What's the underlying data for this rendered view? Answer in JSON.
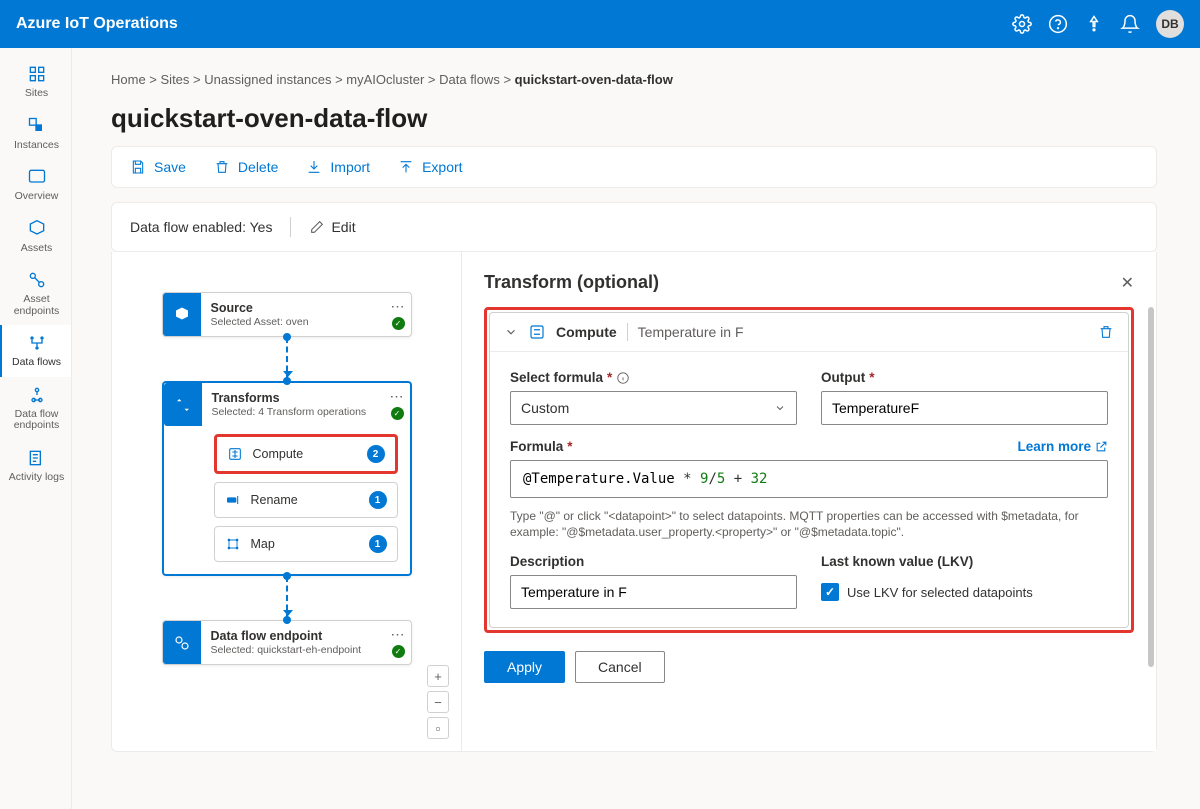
{
  "header": {
    "product": "Azure IoT Operations",
    "avatar": "DB"
  },
  "sidebar": {
    "items": [
      {
        "label": "Sites"
      },
      {
        "label": "Instances"
      },
      {
        "label": "Overview"
      },
      {
        "label": "Assets"
      },
      {
        "label": "Asset endpoints"
      },
      {
        "label": "Data flows"
      },
      {
        "label": "Data flow endpoints"
      },
      {
        "label": "Activity logs"
      }
    ]
  },
  "breadcrumbs": {
    "parts": [
      "Home",
      "Sites",
      "Unassigned instances",
      "myAIOcluster",
      "Data flows"
    ],
    "current": "quickstart-oven-data-flow"
  },
  "page": {
    "title": "quickstart-oven-data-flow"
  },
  "toolbar": {
    "save": "Save",
    "delete": "Delete",
    "import": "Import",
    "export": "Export"
  },
  "status": {
    "label": "Data flow enabled:",
    "value": "Yes",
    "edit": "Edit"
  },
  "canvas": {
    "source": {
      "title": "Source",
      "subtitle": "Selected Asset: oven"
    },
    "transforms": {
      "title": "Transforms",
      "subtitle": "Selected: 4 Transform operations",
      "ops": [
        {
          "name": "Compute",
          "count": "2"
        },
        {
          "name": "Rename",
          "count": "1"
        },
        {
          "name": "Map",
          "count": "1"
        }
      ]
    },
    "endpoint": {
      "title": "Data flow endpoint",
      "subtitle": "Selected: quickstart-eh-endpoint"
    }
  },
  "panel": {
    "title": "Transform (optional)",
    "card_title": "Compute",
    "card_sub": "Temperature in F",
    "select_formula_label": "Select formula",
    "select_formula_value": "Custom",
    "output_label": "Output",
    "output_value": "TemperatureF",
    "formula_label": "Formula",
    "formula_at": "@Temperature.Value",
    "formula_rest1": " * ",
    "formula_num1": "9",
    "formula_slash": "/",
    "formula_num2": "5",
    "formula_plus": " + ",
    "formula_num3": "32",
    "learn_more": "Learn more",
    "formula_hint": "Type \"@\" or click \"<datapoint>\" to select datapoints. MQTT properties can be accessed with $metadata, for example: \"@$metadata.user_property.<property>\" or \"@$metadata.topic\".",
    "description_label": "Description",
    "description_value": "Temperature in F",
    "lkv_label": "Last known value (LKV)",
    "lkv_text": "Use LKV for selected datapoints",
    "apply": "Apply",
    "cancel": "Cancel"
  }
}
